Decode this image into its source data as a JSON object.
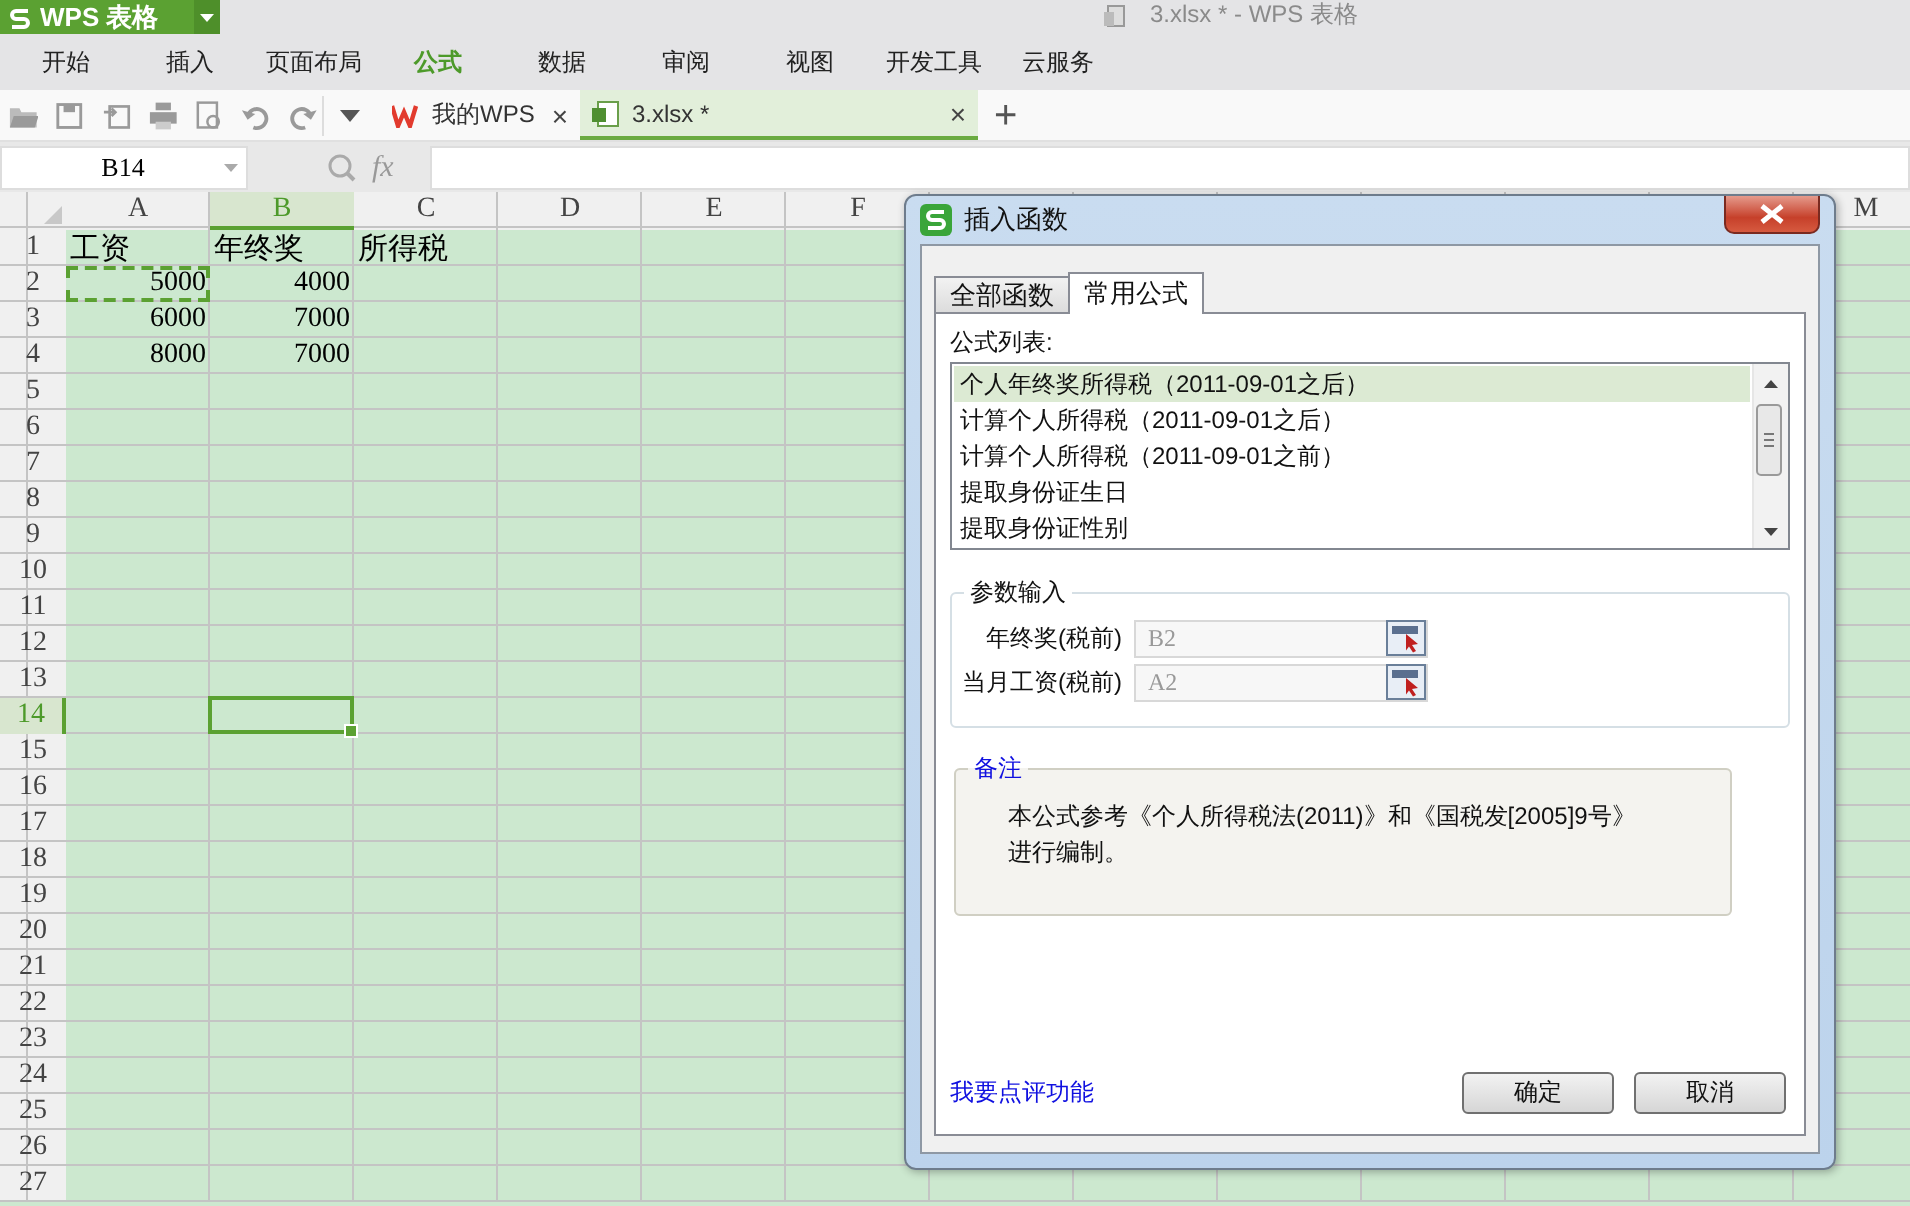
{
  "app": {
    "button": "WPS 表格",
    "title": "3.xlsx * - WPS 表格"
  },
  "menu": [
    {
      "label": "开始",
      "selected": false
    },
    {
      "label": "插入",
      "selected": false
    },
    {
      "label": "页面布局",
      "selected": false
    },
    {
      "label": "公式",
      "selected": true
    },
    {
      "label": "数据",
      "selected": false
    },
    {
      "label": "审阅",
      "selected": false
    },
    {
      "label": "视图",
      "selected": false
    },
    {
      "label": "开发工具",
      "selected": false
    },
    {
      "label": "云服务",
      "selected": false
    }
  ],
  "toolbar": {
    "tabs": [
      {
        "label": "我的WPS",
        "close": "×",
        "selected": false
      },
      {
        "label": "3.xlsx *",
        "close": "×",
        "selected": true
      }
    ],
    "new_tab": "+"
  },
  "formula_bar": {
    "name_box": "B14",
    "fx": "fx"
  },
  "sheet": {
    "columns": [
      {
        "label": "A",
        "selected": false
      },
      {
        "label": "B",
        "selected": true
      },
      {
        "label": "C",
        "selected": false
      },
      {
        "label": "D",
        "selected": false
      },
      {
        "label": "E",
        "selected": false
      },
      {
        "label": "F",
        "selected": false
      },
      {
        "label": "M",
        "selected": false
      }
    ],
    "rows": [
      {
        "label": "1",
        "selected": false,
        "cells": [
          {
            "text": "工资",
            "kind": "text",
            "copied": false
          },
          {
            "text": "年终奖",
            "kind": "text",
            "copied": false
          },
          {
            "text": "所得税",
            "kind": "text",
            "copied": false
          }
        ]
      },
      {
        "label": "2",
        "selected": false,
        "cells": [
          {
            "text": "5000",
            "kind": "number",
            "copied": true
          },
          {
            "text": "4000",
            "kind": "number",
            "copied": false
          }
        ]
      },
      {
        "label": "3",
        "selected": false,
        "cells": [
          {
            "text": "6000",
            "kind": "number",
            "copied": false
          },
          {
            "text": "7000",
            "kind": "number",
            "copied": false
          }
        ]
      },
      {
        "label": "4",
        "selected": false,
        "cells": [
          {
            "text": "8000",
            "kind": "number",
            "copied": false
          },
          {
            "text": "7000",
            "kind": "number",
            "copied": false
          }
        ]
      },
      {
        "label": "5",
        "selected": false
      },
      {
        "label": "6",
        "selected": false
      },
      {
        "label": "7",
        "selected": false
      },
      {
        "label": "8",
        "selected": false
      },
      {
        "label": "9",
        "selected": false
      },
      {
        "label": "10",
        "selected": false
      },
      {
        "label": "11",
        "selected": false
      },
      {
        "label": "12",
        "selected": false
      },
      {
        "label": "13",
        "selected": false
      },
      {
        "label": "14",
        "selected": true
      },
      {
        "label": "15",
        "selected": false
      },
      {
        "label": "16",
        "selected": false
      },
      {
        "label": "17",
        "selected": false
      },
      {
        "label": "18",
        "selected": false
      },
      {
        "label": "19",
        "selected": false
      },
      {
        "label": "20",
        "selected": false
      },
      {
        "label": "21",
        "selected": false
      },
      {
        "label": "22",
        "selected": false
      },
      {
        "label": "23",
        "selected": false
      },
      {
        "label": "24",
        "selected": false
      },
      {
        "label": "25",
        "selected": false
      },
      {
        "label": "26",
        "selected": false
      },
      {
        "label": "27",
        "selected": false
      }
    ]
  },
  "dialog": {
    "title": "插入函数",
    "tabs": [
      {
        "label": "全部函数",
        "selected": false
      },
      {
        "label": "常用公式",
        "selected": true
      }
    ],
    "list_label": "公式列表:",
    "formulas": [
      {
        "label": "个人年终奖所得税（2011-09-01之后）",
        "selected": true
      },
      {
        "label": "计算个人所得税（2011-09-01之后）",
        "selected": false
      },
      {
        "label": "计算个人所得税（2011-09-01之前）",
        "selected": false
      },
      {
        "label": "提取身份证生日",
        "selected": false
      },
      {
        "label": "提取身份证性别",
        "selected": false
      }
    ],
    "parameters": {
      "legend": "参数输入",
      "fields": [
        {
          "label": "年终奖(税前)",
          "value": "B2"
        },
        {
          "label": "当月工资(税前)",
          "value": "A2"
        }
      ]
    },
    "note": {
      "legend": "备注",
      "text": "本公式参考《个人所得税法(2011)》和《国税发[2005]9号》进行编制。"
    },
    "link": "我要点评功能",
    "buttons": [
      "确定",
      "取消"
    ]
  }
}
